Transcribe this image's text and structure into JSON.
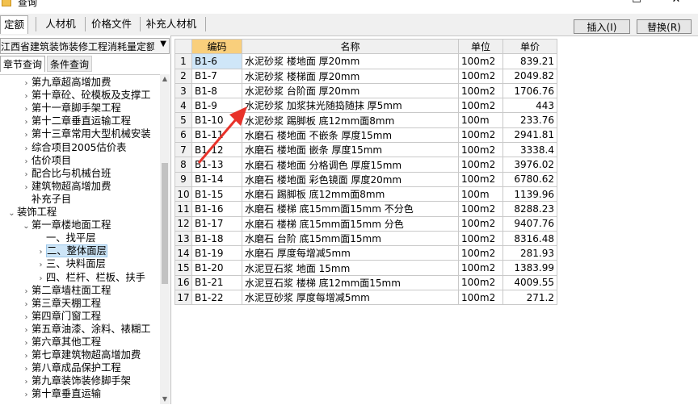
{
  "window": {
    "title": "查询",
    "minimize": "—",
    "maximize": "☐",
    "close": "✕"
  },
  "tabs": [
    "定额",
    "人材机",
    "价格文件",
    "补充人材机"
  ],
  "buttons": {
    "insert": "插入(I)",
    "replace": "替换(R)"
  },
  "library": "江西省建筑装饰装修工程消耗量定额",
  "subtabs": [
    "章节查询",
    "条件查询"
  ],
  "tree": [
    {
      "label": "第九章超高增加费",
      "level": 2,
      "expander": "›"
    },
    {
      "label": "第十章砼、砼模板及支撑工",
      "level": 2,
      "expander": "›"
    },
    {
      "label": "第十一章脚手架工程",
      "level": 2,
      "expander": "›"
    },
    {
      "label": "第十二章垂直运输工程",
      "level": 2,
      "expander": "›"
    },
    {
      "label": "第十三章常用大型机械安装",
      "level": 2,
      "expander": "›"
    },
    {
      "label": "综合项目2005估价表",
      "level": 2,
      "expander": "›"
    },
    {
      "label": "估价项目",
      "level": 2,
      "expander": "›"
    },
    {
      "label": "配合比与机械台班",
      "level": 2,
      "expander": "›"
    },
    {
      "label": "建筑物超高增加费",
      "level": 2,
      "expander": "›"
    },
    {
      "label": "补充子目",
      "level": 2,
      "expander": ""
    },
    {
      "label": "装饰工程",
      "level": 1,
      "expander": "⌄"
    },
    {
      "label": "第一章楼地面工程",
      "level": 2,
      "expander": "⌄"
    },
    {
      "label": "一、找平层",
      "level": 3,
      "expander": ""
    },
    {
      "label": "二、整体面层",
      "level": 3,
      "expander": "›",
      "selected": true
    },
    {
      "label": "三、块料面层",
      "level": 3,
      "expander": "›"
    },
    {
      "label": "四、栏杆、栏板、扶手",
      "level": 3,
      "expander": "›"
    },
    {
      "label": "第二章墙柱面工程",
      "level": 2,
      "expander": "›"
    },
    {
      "label": "第三章天棚工程",
      "level": 2,
      "expander": "›"
    },
    {
      "label": "第四章门窗工程",
      "level": 2,
      "expander": "›"
    },
    {
      "label": "第五章油漆、涂料、裱糊工",
      "level": 2,
      "expander": "›"
    },
    {
      "label": "第六章其他工程",
      "level": 2,
      "expander": "›"
    },
    {
      "label": "第七章建筑物超高增加费",
      "level": 2,
      "expander": "›"
    },
    {
      "label": "第八章成品保护工程",
      "level": 2,
      "expander": "›"
    },
    {
      "label": "第九章装饰装修脚手架",
      "level": 2,
      "expander": "›"
    },
    {
      "label": "第十章垂直运输",
      "level": 2,
      "expander": "›"
    }
  ],
  "table": {
    "headers": [
      "",
      "编码",
      "名称",
      "单位",
      "单价"
    ],
    "rows": [
      [
        "1",
        "B1-6",
        "水泥砂浆 楼地面 厚20mm",
        "100m2",
        "839.21"
      ],
      [
        "2",
        "B1-7",
        "水泥砂浆 楼梯面 厚20mm",
        "100m2",
        "2049.82"
      ],
      [
        "3",
        "B1-8",
        "水泥砂浆 台阶面 厚20mm",
        "100m2",
        "1706.76"
      ],
      [
        "4",
        "B1-9",
        "水泥砂浆 加浆抹光随捣随抹 厚5mm",
        "100m2",
        "443"
      ],
      [
        "5",
        "B1-10",
        "水泥砂浆 踢脚板 底12mm面8mm",
        "100m",
        "233.76"
      ],
      [
        "6",
        "B1-11",
        "水磨石 楼地面 不嵌条 厚度15mm",
        "100m2",
        "2941.81"
      ],
      [
        "7",
        "B1-12",
        "水磨石 楼地面 嵌条 厚度15mm",
        "100m2",
        "3338.4"
      ],
      [
        "8",
        "B1-13",
        "水磨石 楼地面 分格调色 厚度15mm",
        "100m2",
        "3976.02"
      ],
      [
        "9",
        "B1-14",
        "水磨石 楼地面 彩色镜面 厚度20mm",
        "100m2",
        "6780.62"
      ],
      [
        "10",
        "B1-15",
        "水磨石 踢脚板 底12mm面8mm",
        "100m",
        "1139.96"
      ],
      [
        "11",
        "B1-16",
        "水磨石 楼梯 底15mm面15mm 不分色",
        "100m2",
        "8288.23"
      ],
      [
        "12",
        "B1-17",
        "水磨石 楼梯 底15mm面15mm 分色",
        "100m2",
        "9407.76"
      ],
      [
        "13",
        "B1-18",
        "水磨石 台阶 底15mm面15mm",
        "100m2",
        "8316.48"
      ],
      [
        "14",
        "B1-19",
        "水磨石 厚度每增减5mm",
        "100m2",
        "281.93"
      ],
      [
        "15",
        "B1-20",
        "水泥豆石浆 地面 15mm",
        "100m2",
        "1383.99"
      ],
      [
        "16",
        "B1-21",
        "水泥豆石浆 楼梯 底12mm面15mm",
        "100m2",
        "4009.55"
      ],
      [
        "17",
        "B1-22",
        "水泥豆砂浆 厚度每增减5mm",
        "100m2",
        "271.2"
      ]
    ]
  },
  "colors": {
    "header_highlight": "#f9cf7c",
    "selected_cell": "#cfe6f8",
    "arrow": "#e8322a"
  }
}
